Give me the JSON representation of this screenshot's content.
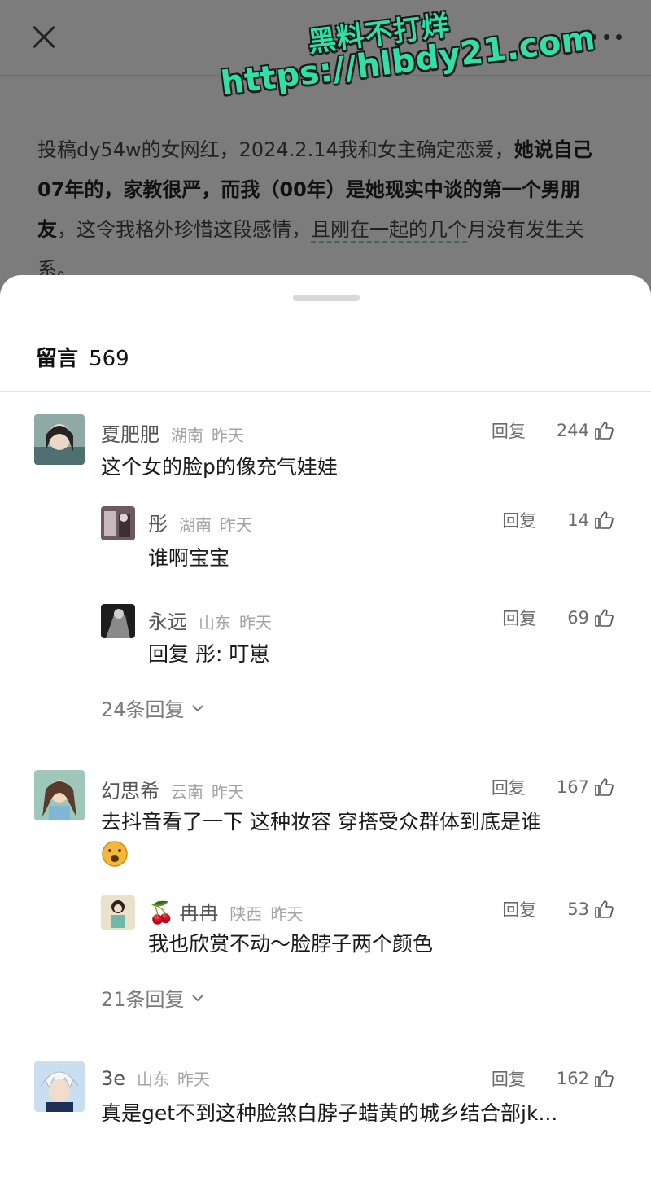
{
  "watermark": {
    "line1": "黑料不打烊",
    "line2": "https://hlbdy21.com"
  },
  "article": {
    "p1": "投稿dy54w的女网红，2024.2.14我和女主确定恋爱，",
    "p1_strong": "她说自己07年的，家教很严，而我（00年）是她现实中谈的第一个男朋友",
    "p1_rest": "，这令我格外珍惜这段感情，",
    "p1_dashed": "且刚在一起的几个",
    "p1_tail": "月没有发生关系。"
  },
  "comments_sheet": {
    "title": "留言",
    "count": "569",
    "reply_label": "回复",
    "comments": [
      {
        "name": "夏肥肥",
        "location": "湖南",
        "time": "昨天",
        "likes": "244",
        "text": "这个女的脸p的像充气娃娃",
        "replies": [
          {
            "name": "彤",
            "location": "湖南",
            "time": "昨天",
            "likes": "14",
            "text": "谁啊宝宝"
          },
          {
            "name": "永远",
            "location": "山东",
            "time": "昨天",
            "likes": "69",
            "text": "回复 彤: 叮崽"
          }
        ],
        "more_replies": "24条回复"
      },
      {
        "name": "幻思希",
        "location": "云南",
        "time": "昨天",
        "likes": "167",
        "text": "去抖音看了一下 这种妆容 穿搭受众群体到底是谁",
        "replies": [
          {
            "name": "冉冉",
            "name_prefix": "🍒",
            "location": "陕西",
            "time": "昨天",
            "likes": "53",
            "text": "我也欣赏不动～脸脖子两个颜色"
          }
        ],
        "more_replies": "21条回复"
      },
      {
        "name": "3e",
        "location": "山东",
        "time": "昨天",
        "likes": "162",
        "text": "真是get不到这种脸煞白脖子蜡黄的城乡结合部jk..."
      }
    ]
  },
  "icons": {
    "close": "close-icon",
    "more": "more-dots-icon",
    "like": "thumbs-up-icon",
    "expand": "chevron-down-icon",
    "emoji": "emoji-icon"
  }
}
